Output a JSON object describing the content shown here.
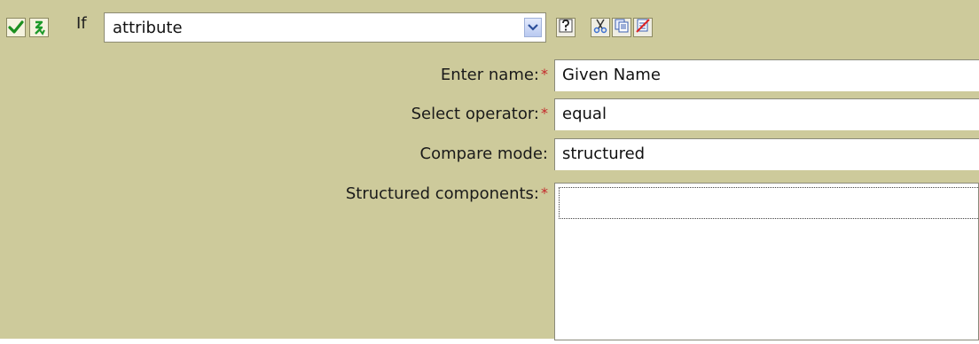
{
  "toolbar": {
    "if_label": "If",
    "condition_select": {
      "value": "attribute"
    },
    "icons": [
      "check-icon",
      "negate-icon",
      "help-icon",
      "cut-icon",
      "copy-icon",
      "delete-icon"
    ]
  },
  "form": {
    "enter_name": {
      "label": "Enter name:",
      "required": "*",
      "value": "Given Name"
    },
    "select_operator": {
      "label": "Select operator:",
      "required": "*",
      "value": "equal"
    },
    "compare_mode": {
      "label": "Compare mode:",
      "value": "structured"
    },
    "structured_components": {
      "label": "Structured components:",
      "required": "*",
      "value": ""
    }
  },
  "colors": {
    "panel_bg": "#cdca9b",
    "required_star": "#c4272a"
  }
}
